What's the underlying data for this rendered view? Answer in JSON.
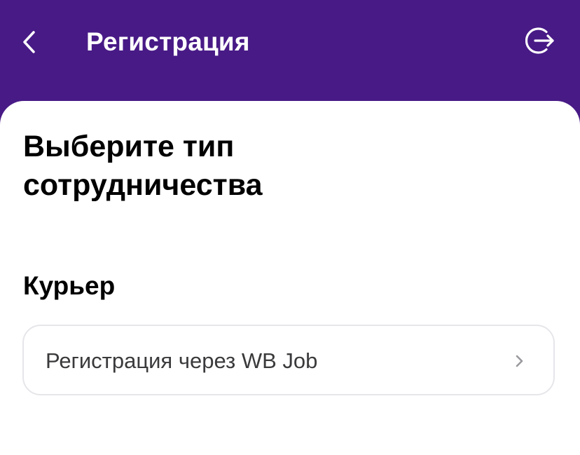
{
  "header": {
    "title": "Регистрация",
    "back_icon": "chevron-left-icon",
    "logout_icon": "logout-arrow-icon"
  },
  "main": {
    "heading": "Выберите тип сотрудничества",
    "section_label": "Курьер",
    "option": {
      "label": "Регистрация через WB Job",
      "icon": "chevron-right-icon"
    }
  },
  "colors": {
    "header_bg": "#481a86",
    "card_border": "#e6e6ea",
    "text_primary": "#000000",
    "text_secondary": "#3a3a3c",
    "chevron": "#9a9a9f"
  }
}
